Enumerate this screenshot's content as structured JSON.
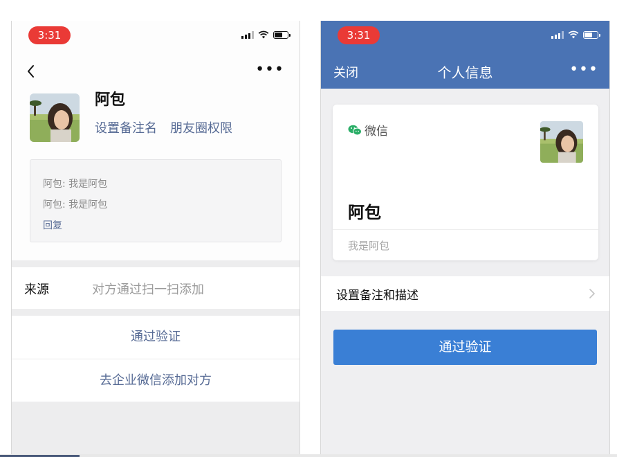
{
  "left": {
    "status": {
      "time": "3:31"
    },
    "profile": {
      "name": "阿包",
      "set_remark": "设置备注名",
      "moments_permission": "朋友圈权限"
    },
    "messages": [
      "阿包: 我是阿包",
      "阿包: 我是阿包"
    ],
    "reply_label": "回复",
    "source": {
      "label": "来源",
      "value": "对方通过扫一扫添加"
    },
    "actions": {
      "verify": "通过验证",
      "add_via_work": "去企业微信添加对方"
    }
  },
  "right": {
    "status": {
      "time": "3:31"
    },
    "navbar": {
      "close": "关闭",
      "title": "个人信息"
    },
    "card": {
      "source_tag": "微信",
      "name": "阿包",
      "signature": "我是阿包"
    },
    "remark_row": "设置备注和描述",
    "verify_button": "通过验证"
  },
  "colors": {
    "link": "#576b95",
    "navbar": "#4a73b4",
    "primary_button": "#3a7fd5",
    "time_pill": "#ea3a36",
    "wechat_green": "#2aae67"
  }
}
